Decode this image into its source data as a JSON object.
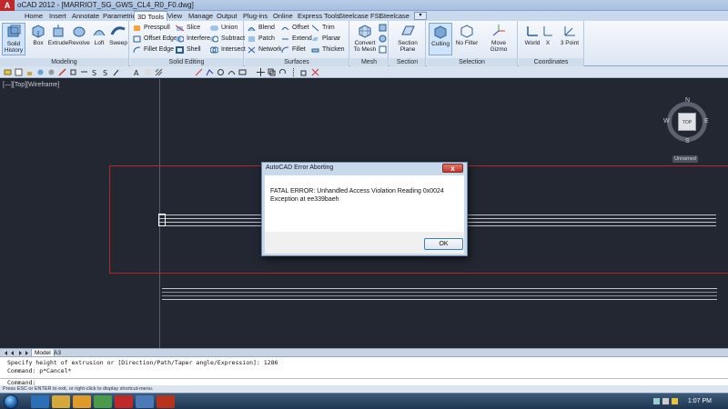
{
  "window": {
    "title": "oCAD 2012 - [MARRIOT_SG_GWS_CL4_R0_F0.dwg]"
  },
  "ribbon_tabs": [
    "Home",
    "Insert",
    "Annotate",
    "Parametric",
    "3D Tools",
    "View",
    "Manage",
    "Output",
    "Plug-ins",
    "Online",
    "Express Tools",
    "Steelcase FSL",
    "Steelcase"
  ],
  "active_tab": "3D Tools",
  "panels": {
    "modeling": {
      "title": "Modeling",
      "solid_history": "Solid History",
      "box": "Box",
      "extrude": "Extrude",
      "revolve": "Revolve",
      "loft": "Loft",
      "sweep": "Sweep"
    },
    "solid_editing": {
      "title": "Solid Editing",
      "presspull": "Presspull",
      "offset_edge": "Offset Edge",
      "fillet_edge": "Fillet Edge",
      "slice": "Slice",
      "interfere": "Interfere",
      "shell": "Shell",
      "union": "Union",
      "subtract": "Subtract",
      "intersect": "Intersect"
    },
    "surfaces": {
      "title": "Surfaces",
      "blend": "Blend",
      "patch": "Patch",
      "network": "Network",
      "offset": "Offset",
      "extend": "Extend",
      "fillet": "Fillet",
      "trim": "Trim",
      "planar": "Planar",
      "thicken": "Thicken"
    },
    "mesh": {
      "title": "Mesh",
      "convert": "Convert To Mesh"
    },
    "section": {
      "title": "Section",
      "section_plane": "Section Plane"
    },
    "selection": {
      "title": "Selection",
      "culling": "Culling",
      "no_filter": "No Filter",
      "move_gizmo": "Move Gizmo"
    },
    "coordinates": {
      "title": "Coordinates",
      "world": "World",
      "x": "X",
      "three_point": "3 Point"
    }
  },
  "viewport": {
    "label": "[—][Top][Wireframe]"
  },
  "viewcube": {
    "n": "N",
    "s": "S",
    "e": "E",
    "w": "W",
    "face": "TOP",
    "ucs": "Unnamed"
  },
  "dialog": {
    "title": "AutoCAD Error Aborting",
    "message": "FATAL ERROR:  Unhandled Access Violation Reading 0x0024 Exception at ee339baeh",
    "ok": "OK",
    "close": "x"
  },
  "layout_tabs": [
    "Model",
    "A3"
  ],
  "command": {
    "line1": "Specify height of extrusion or [Direction/Path/Taper angle/Expression]: 1286",
    "line2": "Command: p*Cancel*",
    "prompt": "Command:"
  },
  "status": {
    "text": "Press ESC or ENTER to exit, or right-click to display shortcut-menu."
  },
  "taskbar": {
    "clock": "1:07 PM"
  },
  "colors": {
    "canvas": "#222731",
    "frame": "#b02a2a",
    "accent": "#3c7fb1"
  }
}
